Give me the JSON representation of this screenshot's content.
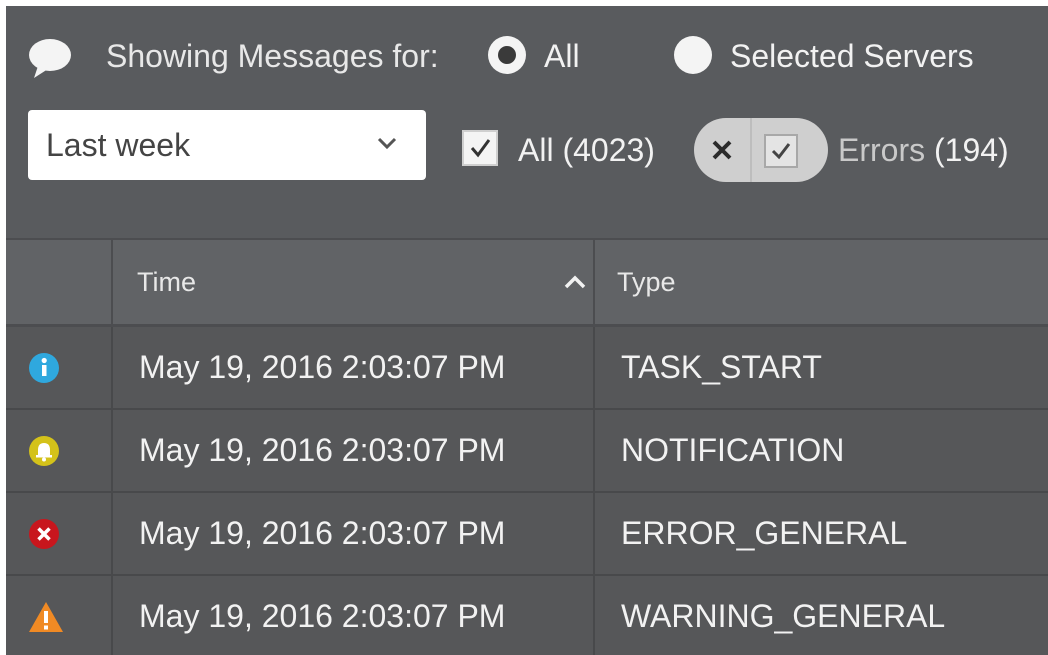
{
  "filter": {
    "showing_label": "Showing Messages for:",
    "options": [
      {
        "label": "All",
        "selected": true
      },
      {
        "label": "Selected Servers",
        "selected": false
      }
    ]
  },
  "range": {
    "selected": "Last week"
  },
  "checkbox_all": {
    "label": "All",
    "count": "(4023)",
    "checked": true
  },
  "errors_filter": {
    "label": "Errors",
    "count": "(194)"
  },
  "table": {
    "columns": [
      "",
      "Time",
      "Type"
    ],
    "sort": {
      "column": "Time",
      "direction": "ascending"
    },
    "rows": [
      {
        "icon": "info-icon",
        "icon_color": "#2fa8de",
        "time": "May 19, 2016 2:03:07 PM",
        "type": "TASK_START"
      },
      {
        "icon": "bell-icon",
        "icon_color": "#d4c21a",
        "time": "May 19, 2016 2:03:07 PM",
        "type": "NOTIFICATION"
      },
      {
        "icon": "error-icon",
        "icon_color": "#c8161d",
        "time": "May 19, 2016 2:03:07 PM",
        "type": "ERROR_GENERAL"
      },
      {
        "icon": "warning-icon",
        "icon_color": "#f08a24",
        "time": "May 19, 2016 2:03:07 PM",
        "type": "WARNING_GENERAL"
      }
    ]
  },
  "colors": {
    "panel_bg": "#595b5e",
    "header_bg": "#616366",
    "row_bg": "#565759",
    "text": "#f2f2f2"
  }
}
